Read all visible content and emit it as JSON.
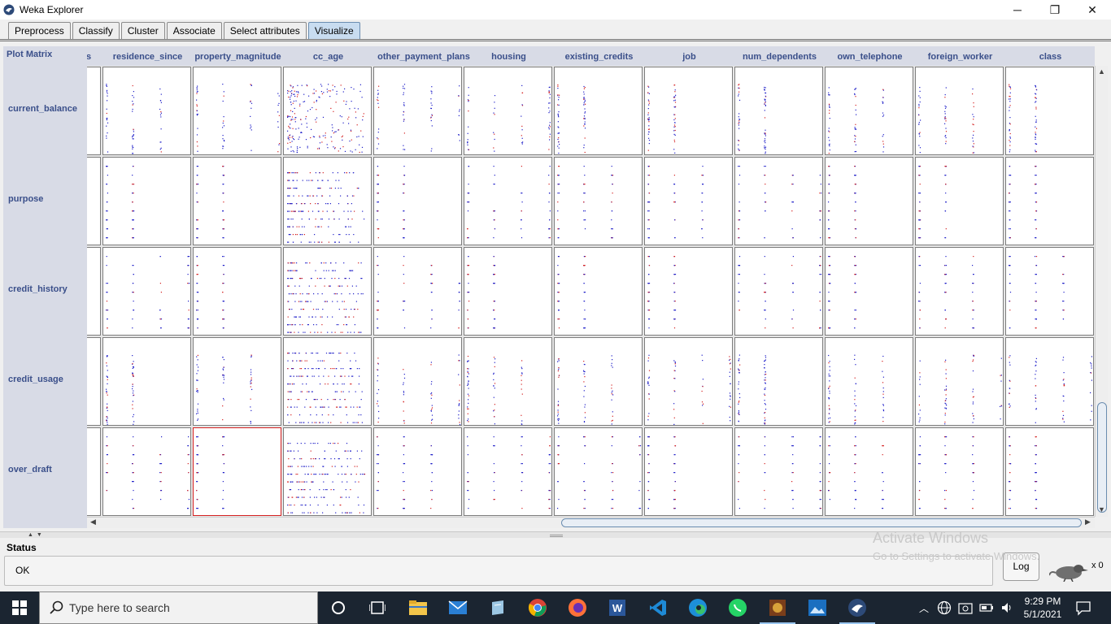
{
  "window": {
    "title": "Weka Explorer",
    "icon": "weka-bird-icon",
    "controls": {
      "minimize": "─",
      "maximize": "❐",
      "close": "✕"
    }
  },
  "tabs": [
    {
      "label": "Preprocess",
      "active": false
    },
    {
      "label": "Classify",
      "active": false
    },
    {
      "label": "Cluster",
      "active": false
    },
    {
      "label": "Associate",
      "active": false
    },
    {
      "label": "Select attributes",
      "active": false
    },
    {
      "label": "Visualize",
      "active": true
    }
  ],
  "matrix": {
    "title": "Plot Matrix",
    "truncated_left_column": "s",
    "columns": [
      "residence_since",
      "property_magnitude",
      "cc_age",
      "other_payment_plans",
      "housing",
      "existing_credits",
      "job",
      "num_dependents",
      "own_telephone",
      "foreign_worker",
      "class"
    ],
    "rows": [
      "current_balance",
      "purpose",
      "credit_history",
      "credit_usage",
      "over_draft"
    ],
    "selected_cell": {
      "row": "over_draft",
      "column": "property_magnitude"
    },
    "colors": {
      "class_good": "#1f1fc8",
      "class_bad": "#d42020",
      "label": "#3a4f8a",
      "panel": "#d8dbe6"
    }
  },
  "status": {
    "label": "Status",
    "text": "OK",
    "log_button": "Log",
    "task_count": "x 0"
  },
  "watermark": {
    "line1": "Activate Windows",
    "line2": "Go to Settings to activate Windows."
  },
  "taskbar": {
    "search_placeholder": "Type here to search",
    "apps": [
      "cortana-icon",
      "task-view-icon",
      "file-explorer-icon",
      "mail-icon",
      "notes-icon",
      "chrome-icon",
      "firefox-icon",
      "word-icon",
      "vscode-icon",
      "edge-icon",
      "whatsapp-icon",
      "game-icon",
      "photos-icon",
      "weka-icon"
    ],
    "time": "9:29 PM",
    "date": "5/1/2021"
  }
}
